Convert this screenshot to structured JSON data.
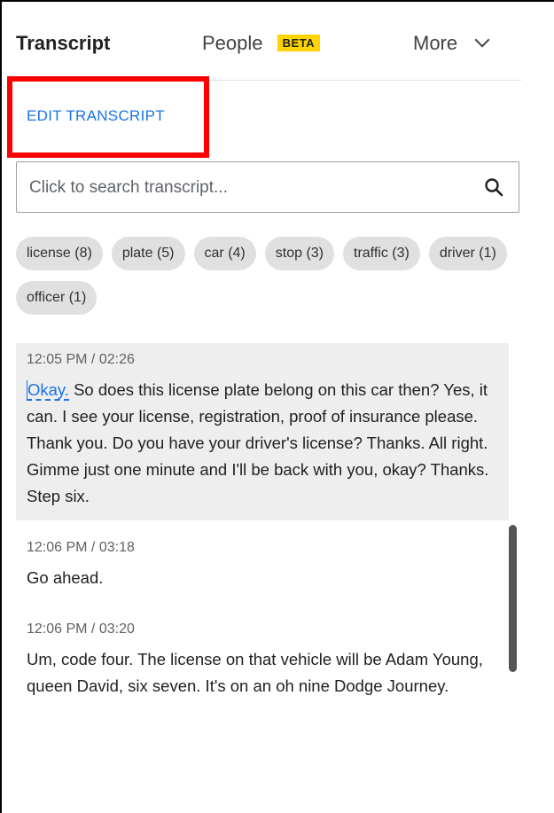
{
  "tabs": {
    "transcript": "Transcript",
    "people": "People",
    "people_badge": "BETA",
    "more": "More"
  },
  "edit_transcript": "EDIT TRANSCRIPT",
  "search": {
    "placeholder": "Click to search transcript...",
    "value": ""
  },
  "keywords": [
    "license (8)",
    "plate (5)",
    "car (4)",
    "stop (3)",
    "traffic (3)",
    "driver (1)",
    "officer (1)"
  ],
  "entries": [
    {
      "time": "12:05 PM / 02:26",
      "first_word": "Okay.",
      "text": " So does this license plate belong on this car then? Yes, it can. I see your license, registration, proof of insurance please. Thank you. Do you have your driver's license? Thanks. All right. Gimme just one minute and I'll be back with you, okay? Thanks. Step six."
    },
    {
      "time": "12:06 PM / 03:18",
      "text": "Go ahead."
    },
    {
      "time": "12:06 PM / 03:20",
      "text": "Um, code four. The license on that vehicle will be Adam Young, queen David, six seven. It's on an oh nine Dodge Journey."
    }
  ],
  "colors": {
    "accent_blue": "#1a73e8",
    "highlight_red": "#ff0000",
    "beta_yellow": "#ffd400",
    "chip_gray": "#e0e0e0",
    "selected_entry_bg": "#eeeeee"
  },
  "icons": {
    "search": "search-icon",
    "more": "chevron-down-icon"
  }
}
